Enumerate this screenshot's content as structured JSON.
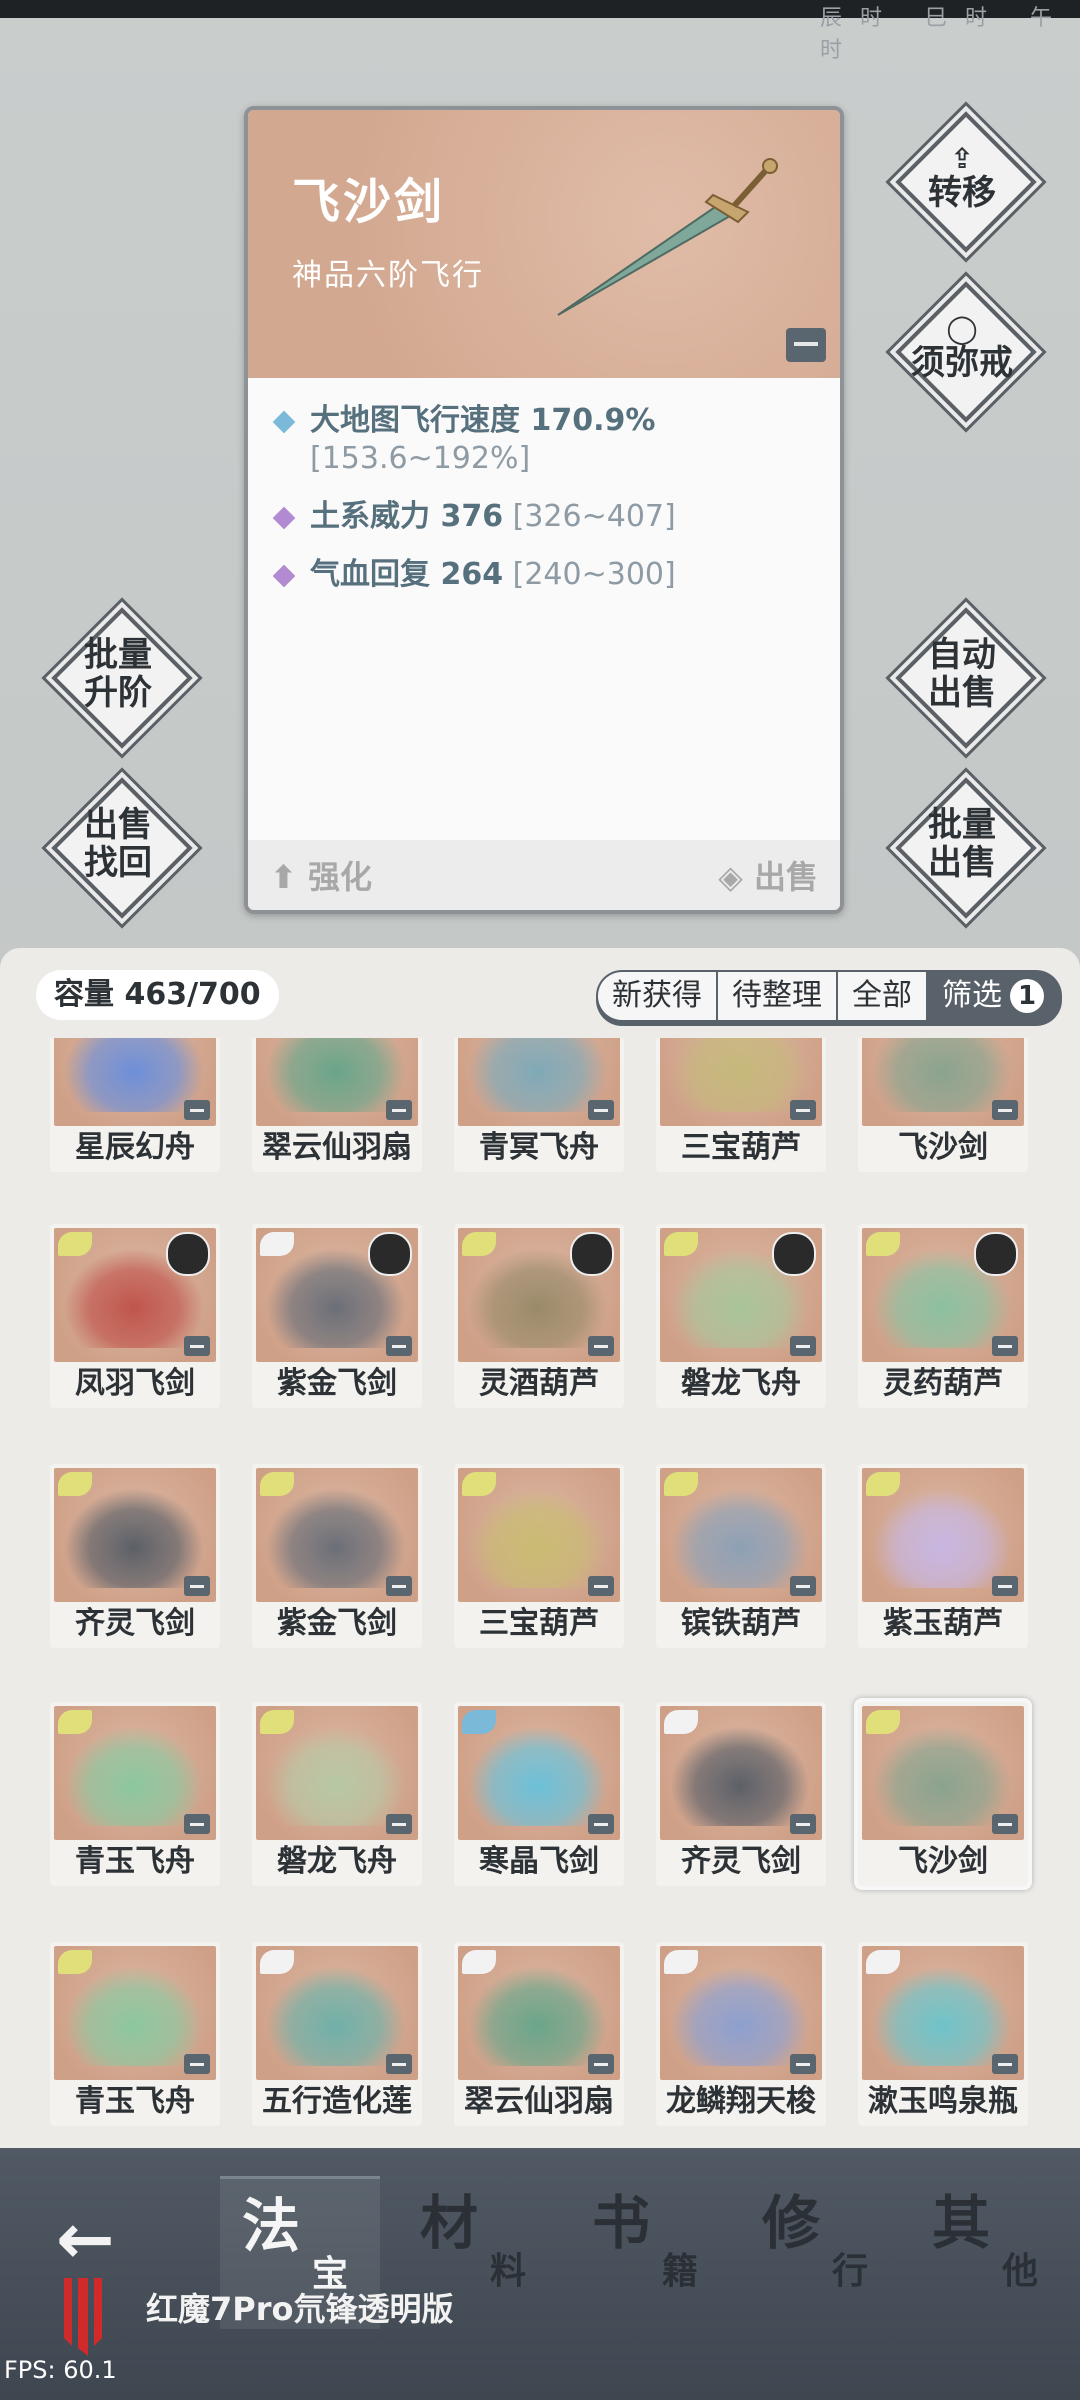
{
  "detail": {
    "name": "飞沙剑",
    "grade": "神品六阶飞行",
    "stats": [
      {
        "name": "大地图飞行速度 170.9%",
        "range": "[153.6~192%]",
        "color": "#7ab9d8"
      },
      {
        "name": "土系威力 376",
        "range": "[326~407]",
        "color": "#b28ad1"
      },
      {
        "name": "气血回复 264",
        "range": "[240~300]",
        "color": "#b28ad1"
      }
    ],
    "upgrade_label": "强化",
    "sell_label": "出售"
  },
  "side_buttons": {
    "transfer": "转移",
    "ring": "须弥戒",
    "batch_upgrade": [
      "批量",
      "升阶"
    ],
    "sell_recover": [
      "出售",
      "找回"
    ],
    "auto_sell": [
      "自动",
      "出售"
    ],
    "batch_sell": [
      "批量",
      "出售"
    ]
  },
  "inventory": {
    "capacity": "容量 463/700",
    "tabs": [
      "新获得",
      "待整理",
      "全部"
    ],
    "filter_label": "筛选",
    "filter_count": "1",
    "items": [
      {
        "name": "星辰幻舟",
        "wing": "none",
        "art": "#6d8fd8",
        "avatar": false,
        "partial": true
      },
      {
        "name": "翠云仙羽扇",
        "wing": "none",
        "art": "#6aa58a",
        "avatar": false,
        "partial": true
      },
      {
        "name": "青冥飞舟",
        "wing": "none",
        "art": "#7fa9b8",
        "avatar": false,
        "partial": true
      },
      {
        "name": "三宝葫芦",
        "wing": "none",
        "art": "#c5b87a",
        "avatar": false,
        "partial": true
      },
      {
        "name": "飞沙剑",
        "wing": "none",
        "art": "#8aa38e",
        "avatar": false,
        "partial": true
      },
      {
        "name": "凤羽飞剑",
        "wing": "#e0df7a",
        "art": "#c0554c",
        "avatar": true
      },
      {
        "name": "紫金飞剑",
        "wing": "#f2f2f2",
        "art": "#6b6f78",
        "avatar": true
      },
      {
        "name": "灵酒葫芦",
        "wing": "#e0df7a",
        "art": "#9a8a6a",
        "avatar": true
      },
      {
        "name": "磐龙飞舟",
        "wing": "#e0df7a",
        "art": "#a9c49a",
        "avatar": true
      },
      {
        "name": "灵药葫芦",
        "wing": "#e0df7a",
        "art": "#8cc0a0",
        "avatar": true
      },
      {
        "name": "齐灵飞剑",
        "wing": "#e0df7a",
        "art": "#5c6068",
        "avatar": false
      },
      {
        "name": "紫金飞剑",
        "wing": "#e0df7a",
        "art": "#6b6f78",
        "avatar": false
      },
      {
        "name": "三宝葫芦",
        "wing": "#e0df7a",
        "art": "#c9bb72",
        "avatar": false
      },
      {
        "name": "镔铁葫芦",
        "wing": "#e0df7a",
        "art": "#8da0b6",
        "avatar": false
      },
      {
        "name": "紫玉葫芦",
        "wing": "#e0df7a",
        "art": "#c7b6e2",
        "avatar": false
      },
      {
        "name": "青玉飞舟",
        "wing": "#e0df7a",
        "art": "#8cc79e",
        "avatar": false
      },
      {
        "name": "磐龙飞舟",
        "wing": "#e0df7a",
        "art": "#b7c7a4",
        "avatar": false
      },
      {
        "name": "寒晶飞剑",
        "wing": "#7ab9d8",
        "art": "#6cc0d8",
        "avatar": false
      },
      {
        "name": "齐灵飞剑",
        "wing": "#f2f2f2",
        "art": "#5c6068",
        "avatar": false
      },
      {
        "name": "飞沙剑",
        "wing": "#e0df7a",
        "art": "#8aa38e",
        "avatar": false,
        "selected": true
      },
      {
        "name": "青玉飞舟",
        "wing": "#e0df7a",
        "art": "#8cc79e",
        "avatar": false
      },
      {
        "name": "五行造化莲",
        "wing": "#f2f2f2",
        "art": "#6fb0a8",
        "avatar": false
      },
      {
        "name": "翠云仙羽扇",
        "wing": "#f2f2f2",
        "art": "#6aa58a",
        "avatar": false
      },
      {
        "name": "龙鳞翔天梭",
        "wing": "#f2f2f2",
        "art": "#8d9fcf",
        "avatar": false
      },
      {
        "name": "漱玉鸣泉瓶",
        "wing": "#f2f2f2",
        "art": "#6ec3c9",
        "avatar": false
      }
    ]
  },
  "nav": {
    "categories": [
      {
        "big": "法",
        "small": "宝",
        "active": true
      },
      {
        "big": "材",
        "small": "料",
        "active": false
      },
      {
        "big": "书",
        "small": "籍",
        "active": false
      },
      {
        "big": "修",
        "small": "行",
        "active": false
      },
      {
        "big": "其",
        "small": "他",
        "active": false
      }
    ],
    "device_label": "红魔7Pro氘锋透明版"
  },
  "fps": "FPS: 60.1",
  "status_bar": "辰时 巳时 午时"
}
